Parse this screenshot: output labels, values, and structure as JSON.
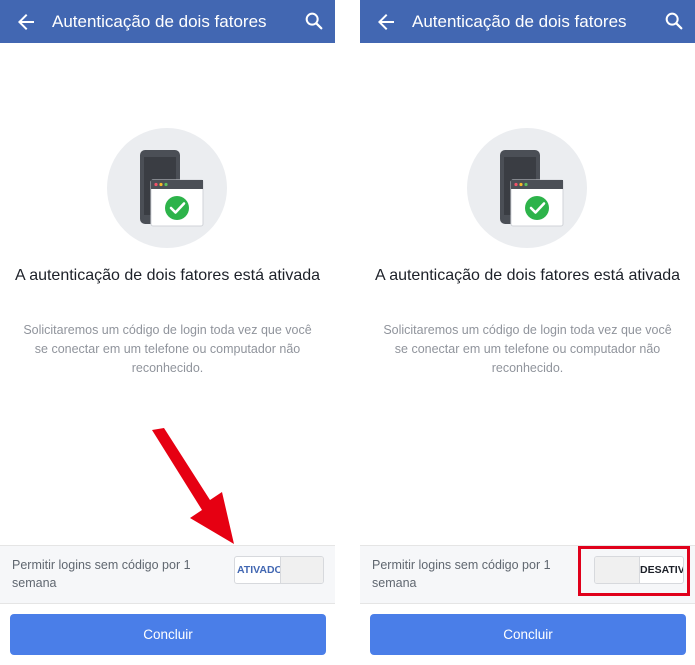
{
  "panels": [
    {
      "appbar": {
        "title": "Autenticação de dois fatores"
      },
      "heading": "A autenticação de dois fatores está ativada",
      "description": "Solicitaremos um código de login toda vez que você se conectar em um telefone ou computador não reconhecido.",
      "setting": {
        "label": "Permitir logins sem código por 1 semana",
        "toggle_text": "ATIVADO",
        "toggle_state": "on"
      },
      "button": {
        "label": "Concluir"
      }
    },
    {
      "appbar": {
        "title": "Autenticação de dois fatores"
      },
      "heading": "A autenticação de dois fatores está ativada",
      "description": "Solicitaremos um código de login toda vez que você se conectar em um telefone ou computador não reconhecido.",
      "setting": {
        "label": "Permitir logins sem código por 1 semana",
        "toggle_text": "DESATIVADO",
        "toggle_state": "off"
      },
      "button": {
        "label": "Concluir"
      }
    }
  ],
  "icons": [
    "back-arrow-icon",
    "search-icon",
    "devices-check-illustration",
    "annotation-arrow",
    "highlight-box"
  ],
  "colors": {
    "appbar": "#4267b2",
    "button": "#4a7ee8",
    "check": "#2db34a",
    "annotation": "#e0001b"
  }
}
